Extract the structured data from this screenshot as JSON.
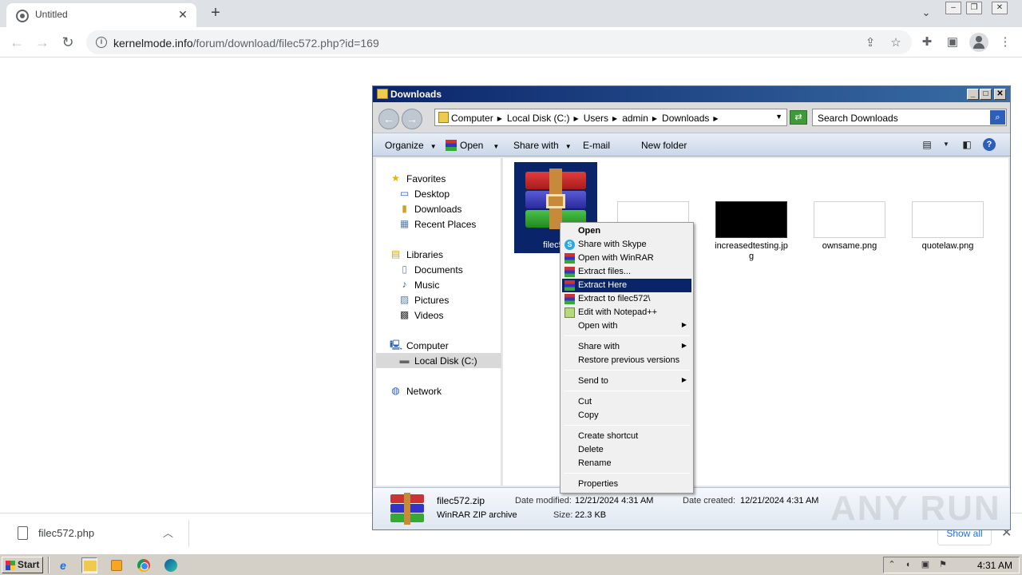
{
  "browser": {
    "tab_title": "Untitled",
    "tab_close": "✕",
    "new_tab": "+",
    "url_host": "kernelmode.info",
    "url_path": "/forum/download/filec572.php?id=169",
    "download": {
      "filename": "filec572.php",
      "show_all": "Show all"
    }
  },
  "explorer": {
    "title": "Downloads",
    "breadcrumbs": [
      "Computer",
      "Local Disk (C:)",
      "Users",
      "admin",
      "Downloads"
    ],
    "search_placeholder": "Search Downloads",
    "commands": {
      "organize": "Organize",
      "open": "Open",
      "share_with": "Share with",
      "email": "E-mail",
      "new_folder": "New folder"
    },
    "nav": {
      "favorites": "Favorites",
      "desktop": "Desktop",
      "downloads": "Downloads",
      "recent_places": "Recent Places",
      "libraries": "Libraries",
      "documents": "Documents",
      "music": "Music",
      "pictures": "Pictures",
      "videos": "Videos",
      "computer": "Computer",
      "local_disk": "Local Disk (C:)",
      "network": "Network"
    },
    "files": {
      "selected_short": "filec57",
      "file2_name": "increasedtesting.jpg",
      "file2_line1": "increasedtesting.jp",
      "file2_line2": "g",
      "file3_name": "ownsame.png",
      "file4_name": "quotelaw.png"
    },
    "details": {
      "filename": "filec572.zip",
      "filetype": "WinRAR ZIP archive",
      "date_modified_label": "Date modified:",
      "date_modified": "12/21/2024 4:31 AM",
      "size_label": "Size:",
      "size": "22.3 KB",
      "date_created_label": "Date created:",
      "date_created": "12/21/2024 4:31 AM"
    }
  },
  "context_menu": {
    "open": "Open",
    "share_skype": "Share with Skype",
    "open_winrar": "Open with WinRAR",
    "extract_files": "Extract files...",
    "extract_here": "Extract Here",
    "extract_to": "Extract to filec572\\",
    "edit_notepad": "Edit with Notepad++",
    "open_with": "Open with",
    "share_with": "Share with",
    "restore_versions": "Restore previous versions",
    "send_to": "Send to",
    "cut": "Cut",
    "copy": "Copy",
    "create_shortcut": "Create shortcut",
    "delete": "Delete",
    "rename": "Rename",
    "properties": "Properties"
  },
  "watermark": "ANY RUN",
  "taskbar": {
    "start": "Start",
    "clock": "4:31 AM"
  }
}
